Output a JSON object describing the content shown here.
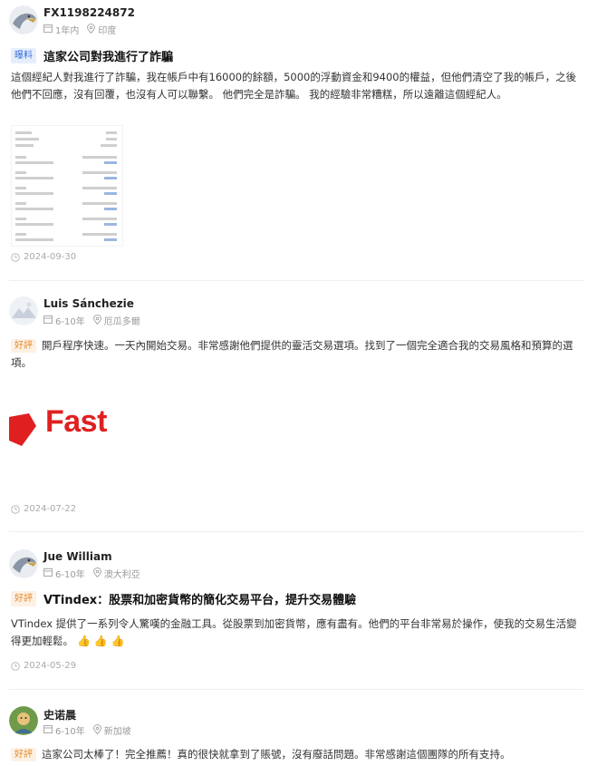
{
  "reviews": [
    {
      "user": "FX1198224872",
      "duration": "1年内",
      "location": "印度",
      "tag": "曝料",
      "title": "這家公司對我進行了詐騙",
      "body": "這個經紀人對我進行了詐騙，我在帳戶中有16000的餘額，5000的浮動資金和9400的權益，但他們清空了我的帳戶，之後他們不回應，沒有回覆，也沒有人可以聯繫。 他們完全是詐騙。 我的經驗非常糟糕，所以遠離這個經紀人。",
      "date": "2024-09-30"
    },
    {
      "user": "Luis Sánchezie",
      "duration": "6-10年",
      "location": "厄瓜多爾",
      "tag": "好評",
      "body": "開戶程序快速。一天內開始交易。非常感謝他們提供的靈活交易選項。找到了一個完全適合我的交易風格和預算的選項。",
      "image_text": "Fast",
      "date": "2024-07-22"
    },
    {
      "user": "Jue William",
      "duration": "6-10年",
      "location": "澳大利亞",
      "tag": "好評",
      "title": "VTindex：股票和加密貨幣的簡化交易平台，提升交易體驗",
      "body": "VTindex 提供了一系列令人驚嘆的金融工具。從股票到加密貨幣，應有盡有。他們的平台非常易於操作，使我的交易生活變得更加輕鬆。",
      "emoji": "👍 👍 👍",
      "date": "2024-05-29"
    },
    {
      "user": "史诺晨",
      "duration": "6-10年",
      "location": "新加坡",
      "tag": "好評",
      "body": "這家公司太棒了！完全推薦！真的很快就拿到了賬號，沒有廢話問題。非常感謝這個團隊的所有支持。"
    }
  ],
  "colors": {
    "exposure_tag": "#3a6fd8",
    "good_tag": "#e88a2c",
    "muted": "#9a9a9a"
  },
  "icons": [
    "avatar-eagle",
    "avatar-mountain",
    "avatar-photo",
    "calendar-icon",
    "location-pin-icon",
    "clock-icon",
    "thumbs-up-icon"
  ]
}
